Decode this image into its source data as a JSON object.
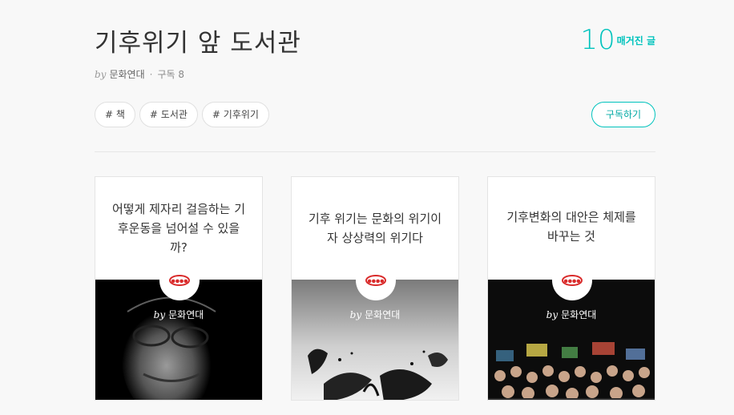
{
  "magazine": {
    "title": "기후위기 앞 도서관",
    "by_label": "by",
    "author": "문화연대",
    "separator": "·",
    "subscribers": "구독 8",
    "article_count": "10",
    "article_count_label": "매거진 글"
  },
  "tags": [
    "# 책",
    "# 도서관",
    "# 기후위기"
  ],
  "subscribe_label": "구독하기",
  "cards": [
    {
      "title": "어떻게 제자리 걸음하는 기후운동을 넘어설 수 있을까?",
      "by": "by",
      "author": "문화연대"
    },
    {
      "title": "기후 위기는 문화의 위기이자 상상력의 위기다",
      "by": "by",
      "author": "문화연대"
    },
    {
      "title": "기후변화의 대안은 체제를 바꾸는 것",
      "by": "by",
      "author": "문화연대"
    }
  ],
  "colors": {
    "accent": "#00c3bd",
    "logo_red": "#d92b2b"
  }
}
